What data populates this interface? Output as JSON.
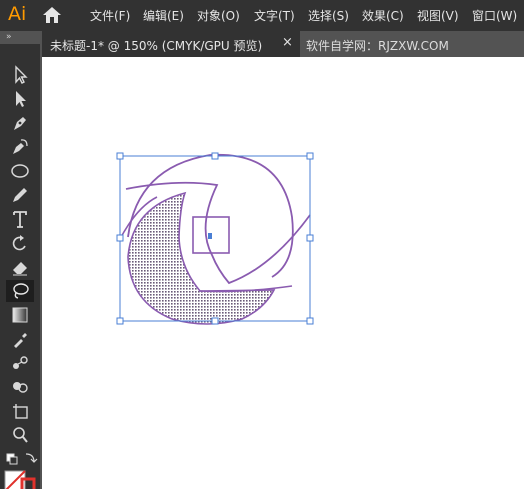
{
  "app": {
    "logo": "Ai"
  },
  "menu": {
    "items": [
      "文件(F)",
      "编辑(E)",
      "对象(O)",
      "文字(T)",
      "选择(S)",
      "效果(C)",
      "视图(V)",
      "窗口(W)"
    ]
  },
  "tabs": {
    "active": {
      "label": "未标题-1* @ 150% (CMYK/GPU 预览)",
      "close": "×"
    },
    "inactive": {
      "label": "软件自学网：RJZXW.COM"
    }
  },
  "toolbar": {
    "collapse": "»",
    "tools": [
      "selection-tool",
      "direct-selection-tool",
      "pen-tool",
      "curvature-tool",
      "ellipse-tool",
      "pencil-tool",
      "type-tool",
      "rotate-tool",
      "eraser-tool",
      "lasso-tool",
      "gradient-tool",
      "eyedropper-tool",
      "blend-tool",
      "shape-builder-tool",
      "artboard-tool",
      "zoom-tool"
    ],
    "active_tool": "lasso-tool",
    "fill_color": "#ffffff",
    "stroke_color": "#e0322c"
  },
  "colors": {
    "artwork_stroke": "#8a5bb0",
    "selection": "#4a7fd4",
    "accent": "#ff9a00"
  }
}
